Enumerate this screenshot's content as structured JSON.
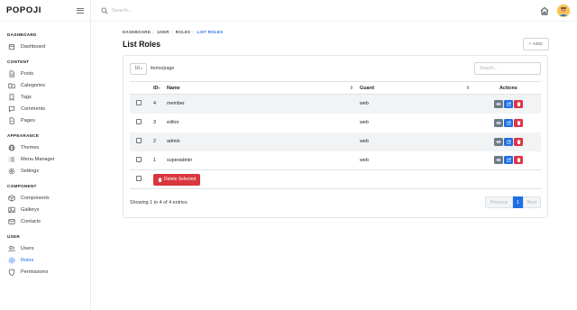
{
  "brand": {
    "name": "POPOJI"
  },
  "topbar": {
    "search_placeholder": "Search..."
  },
  "sidebar": {
    "sections": [
      {
        "title": "DASHBOARD",
        "items": [
          {
            "label": "Dashboard",
            "icon": "calendar-icon"
          }
        ]
      },
      {
        "title": "CONTENT",
        "items": [
          {
            "label": "Posts",
            "icon": "document-icon"
          },
          {
            "label": "Categories",
            "icon": "folder-icon"
          },
          {
            "label": "Tags",
            "icon": "bookmark-icon"
          },
          {
            "label": "Comments",
            "icon": "comment-icon"
          },
          {
            "label": "Pages",
            "icon": "page-icon"
          }
        ]
      },
      {
        "title": "APPEARANCE",
        "items": [
          {
            "label": "Themes",
            "icon": "globe-icon"
          },
          {
            "label": "Menu Manager",
            "icon": "list-icon"
          },
          {
            "label": "Settings",
            "icon": "gear-icon"
          }
        ]
      },
      {
        "title": "COMPONENT",
        "items": [
          {
            "label": "Components",
            "icon": "box-icon"
          },
          {
            "label": "Gallerys",
            "icon": "image-icon"
          },
          {
            "label": "Contacts",
            "icon": "mail-icon"
          }
        ]
      },
      {
        "title": "USER",
        "items": [
          {
            "label": "Users",
            "icon": "users-icon"
          },
          {
            "label": "Roles",
            "icon": "roles-icon",
            "active": true
          },
          {
            "label": "Permissions",
            "icon": "shield-icon"
          }
        ]
      }
    ]
  },
  "breadcrumb": {
    "items": [
      "DASHBOARD",
      "USER",
      "ROLES"
    ],
    "current": "LIST ROLES"
  },
  "page": {
    "title": "List Roles",
    "add_label": "+ ADD"
  },
  "table_controls": {
    "per_page": "10",
    "per_page_label": "items/page",
    "search_placeholder": "Search..."
  },
  "table": {
    "headers": {
      "id": "ID",
      "name": "Name",
      "guard": "Guard",
      "actions": "Actions"
    },
    "rows": [
      {
        "id": "4",
        "name": "member",
        "guard": "web"
      },
      {
        "id": "3",
        "name": "editor",
        "guard": "web"
      },
      {
        "id": "2",
        "name": "admin",
        "guard": "web"
      },
      {
        "id": "1",
        "name": "superadmin",
        "guard": "web"
      }
    ],
    "delete_selected_label": "Delete Selected"
  },
  "footer": {
    "showing": "Showing 1 to 4 of 4 entries",
    "prev": "Previous",
    "page": "1",
    "next": "Next"
  },
  "colors": {
    "accent": "#1e6fe6",
    "danger": "#dc3545",
    "muted": "#6c7a89"
  }
}
